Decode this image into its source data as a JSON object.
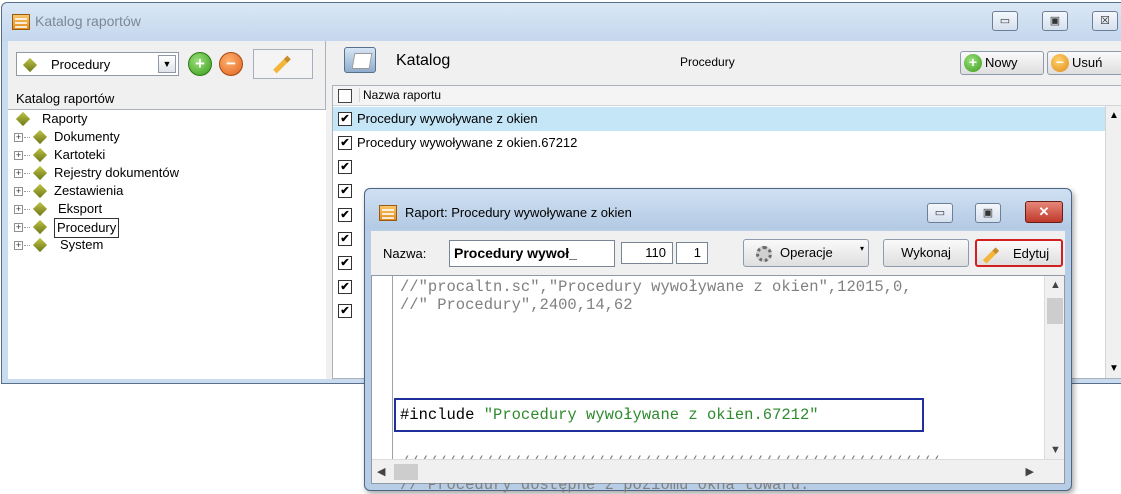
{
  "main_window": {
    "title": "Katalog raportów",
    "caption_minimize": "▭",
    "caption_maximize": "▣",
    "caption_close": "☒"
  },
  "left_panel": {
    "combo_value": "Procedury",
    "combo_arrow": "▼",
    "add_symbol": "+",
    "remove_symbol": "−",
    "label": "Katalog raportów",
    "tree": [
      {
        "label": "Raporty"
      },
      {
        "label": "Dokumenty"
      },
      {
        "label": "Kartoteki"
      },
      {
        "label": "Rejestry dokumentów"
      },
      {
        "label": "Zestawienia"
      },
      {
        "label": "Eksport"
      },
      {
        "label": "Procedury"
      },
      {
        "label": "System"
      }
    ],
    "expander": "+"
  },
  "right_panel": {
    "title": "Katalog",
    "subtitle": "Procedury",
    "new_button": "Nowy",
    "new_symbol": "+",
    "delete_button": "Usuń",
    "delete_symbol": "−",
    "column_header": "Nazwa raportu",
    "rows": [
      {
        "checked": "✔",
        "label": "Procedury wywoływane z okien"
      },
      {
        "checked": "✔",
        "label": "Procedury wywoływane z okien.67212"
      },
      {
        "checked": "✔",
        "label": ""
      },
      {
        "checked": "✔",
        "label": ""
      },
      {
        "checked": "✔",
        "label": ""
      },
      {
        "checked": "✔",
        "label": ""
      },
      {
        "checked": "✔",
        "label": ""
      },
      {
        "checked": "✔",
        "label": ""
      },
      {
        "checked": "✔",
        "label": ""
      }
    ],
    "scroll_up": "▲",
    "scroll_down": "▼"
  },
  "dialog": {
    "title": "Raport: Procedury wywoływane z okien",
    "close_symbol": "✕",
    "name_label": "Nazwa:",
    "name_value": "Procedury wywoł_",
    "num1": "110",
    "num2": "1",
    "operations_button": "Operacje",
    "operations_caret": "▾",
    "run_button": "Wykonaj",
    "edit_button": "Edytuj",
    "code": {
      "line1": "//\"procaltn.sc\",\"Procedury wywoływane z okien\",12015,0,",
      "line2": "//\" Procedury\",2400,14,62",
      "include_keyword": "#include ",
      "include_string": "\"Procedury wywoływane z okien.67212\"",
      "line4": "//////////////////////////////////////////////////////////",
      "line5": "// Procedury dostępne z poziomu okna towaru."
    },
    "scroll_up": "▲",
    "scroll_down": "▼",
    "scroll_left": "◀",
    "scroll_right": "▶"
  }
}
